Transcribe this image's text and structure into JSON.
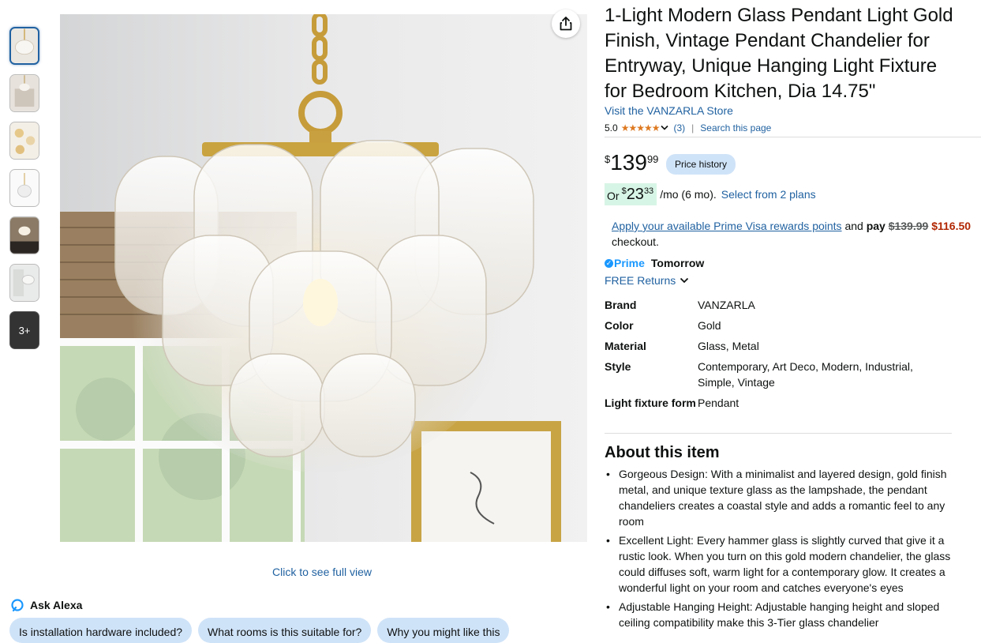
{
  "thumbnails": {
    "more_label": "3+"
  },
  "gallery": {
    "full_view_link": "Click to see full view"
  },
  "alexa": {
    "title": "Ask Alexa",
    "chips": [
      "Is installation hardware included?",
      "What rooms is this suitable for?",
      "Why you might like this"
    ]
  },
  "product": {
    "title": "1-Light Modern Glass Pendant Light Gold Finish, Vintage Pendant Chandelier for Entryway, Unique Hanging Light Fixture for Bedroom Kitchen, Dia 14.75\"",
    "store_link": "Visit the VANZARLA Store",
    "rating_value": "5.0",
    "stars": "★★★★★",
    "rating_count": "(3)",
    "search_page": "Search this page"
  },
  "price": {
    "symbol": "$",
    "whole": "139",
    "fraction": "99",
    "history_button": "Price history"
  },
  "monthly": {
    "or": "Or",
    "symbol": "$",
    "whole": "23",
    "fraction": "33",
    "term": "/mo (6 mo).",
    "plans_link": "Select from 2 plans"
  },
  "prime_visa": {
    "link": "Apply your available Prime Visa rewards points",
    "and": "and",
    "pay": "pay",
    "old_price": "$139.99",
    "new_price": "$116.50",
    "checkout": "checkout."
  },
  "delivery": {
    "prime": "Prime",
    "day": "Tomorrow",
    "returns": "FREE Returns"
  },
  "specs": [
    {
      "key": "Brand",
      "value": "VANZARLA"
    },
    {
      "key": "Color",
      "value": "Gold"
    },
    {
      "key": "Material",
      "value": "Glass, Metal"
    },
    {
      "key": "Style",
      "value": "Contemporary, Art Deco, Modern, Industrial, Simple, Vintage"
    },
    {
      "key": "Light fixture form",
      "value": "Pendant"
    }
  ],
  "about": {
    "heading": "About this item",
    "bullets": [
      "Gorgeous Design: With a minimalist and layered design, gold finish metal, and unique texture glass as the lampshade, the pendant chandeliers creates a coastal style and adds a romantic feel to any room",
      "Excellent Light: Every hammer glass is slightly curved that give it a rustic look. When you turn on this gold modern chandelier, the glass could diffuses soft, warm light for a contemporary glow. It creates a wonderful light on your room and catches everyone's eyes",
      "Adjustable Hanging Height: Adjustable hanging height and sloped ceiling compatibility make this 3-Tier glass chandelier"
    ]
  },
  "colors": {
    "link": "#2162a1",
    "star": "#de7921",
    "chip": "#cfe3f8",
    "prime": "#1a98ff",
    "sale_red": "#b12704"
  }
}
